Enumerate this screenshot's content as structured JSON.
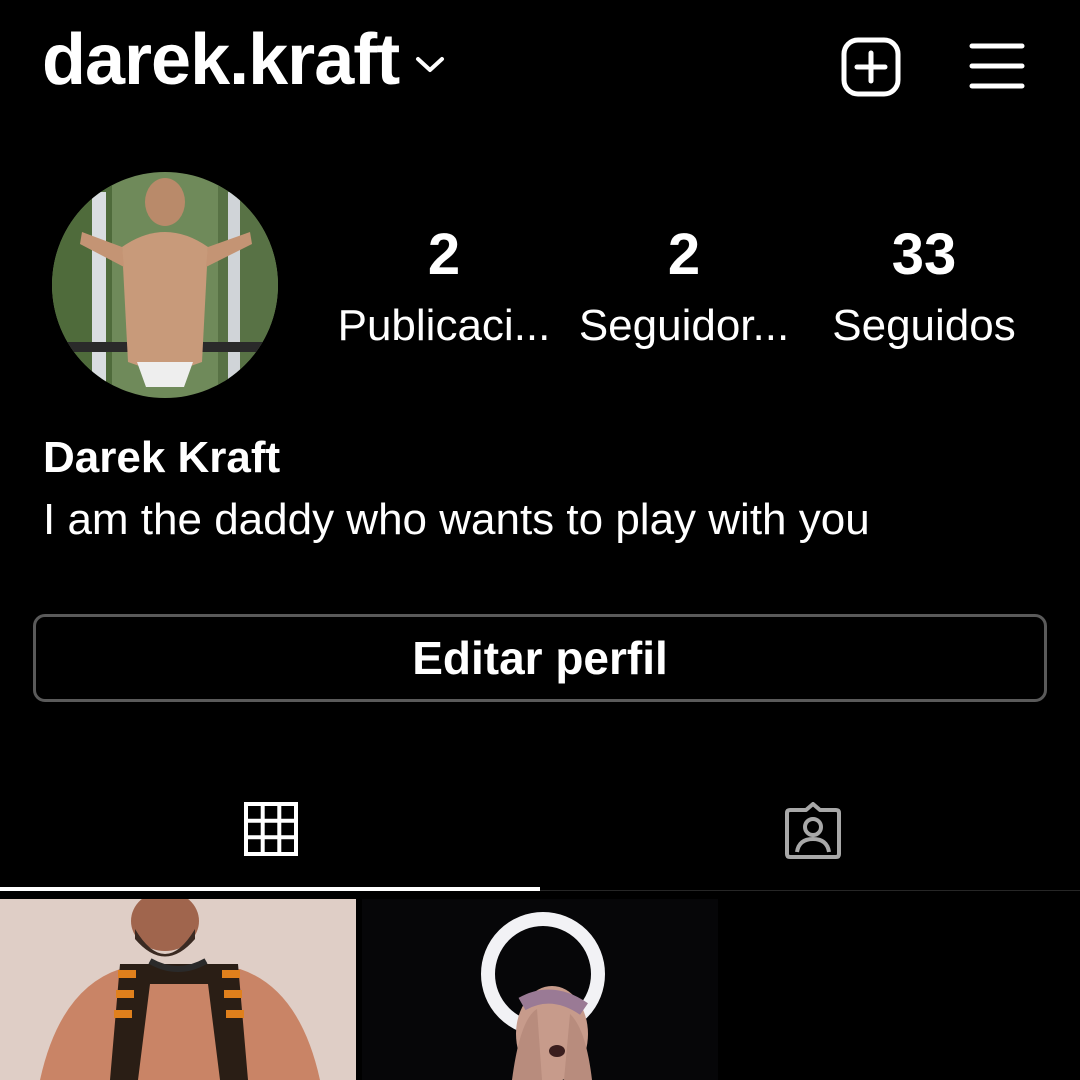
{
  "header": {
    "username": "darek.kraft",
    "username_icon": "chevron-down-icon",
    "add_icon": "plus-square-icon",
    "menu_icon": "hamburger-menu-icon"
  },
  "profile": {
    "avatar_alt": "profile photo",
    "stats": [
      {
        "value": "2",
        "label": "Publicaci..."
      },
      {
        "value": "2",
        "label": "Seguidor..."
      },
      {
        "value": "33",
        "label": "Seguidos"
      }
    ],
    "full_name": "Darek Kraft",
    "bio": "I am the daddy who wants to play with you",
    "edit_button": "Editar perfil"
  },
  "tabs": {
    "active": "grid",
    "items": [
      {
        "icon": "grid-icon"
      },
      {
        "icon": "tagged-person-icon"
      }
    ]
  },
  "colors": {
    "background": "#000000",
    "text": "#ffffff",
    "button_border": "#5a5a5a",
    "divider": "#262626"
  }
}
